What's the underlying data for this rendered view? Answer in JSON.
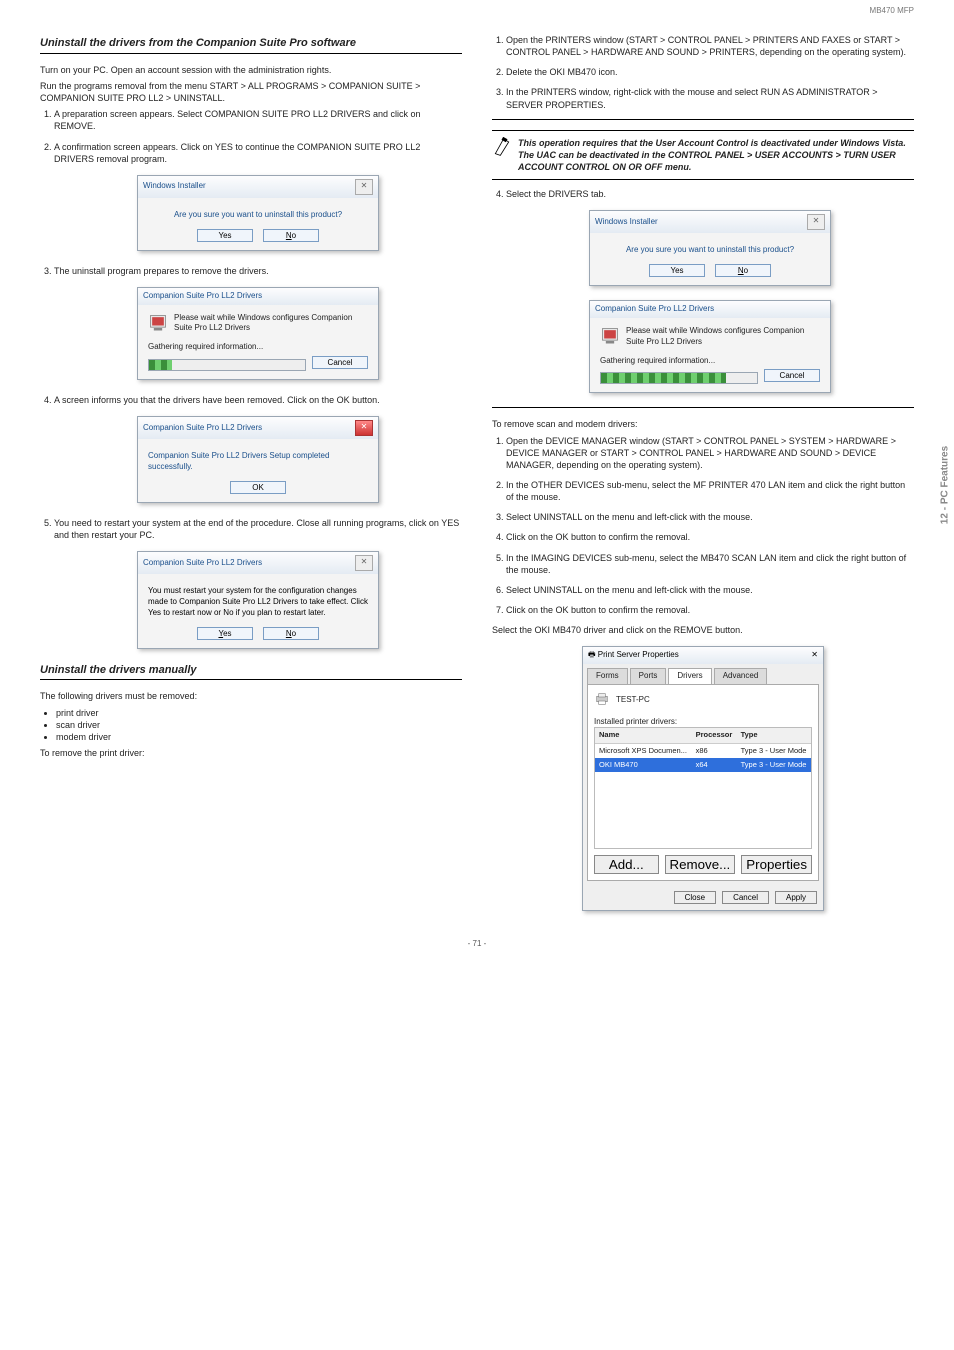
{
  "page_header_right": "MB470 MFP",
  "side_tab": "12 - PC Features",
  "footer": "- 71 -",
  "left": {
    "sec1_title": "Uninstall the drivers from the Companion Suite Pro software",
    "sec1_sub": "Turn on your PC. Open an account session with the administration rights.",
    "sec1_p1_a": "Run the programs removal from the menu START > ALL PROGRAMS > COMPANION SUITE > COMPANION SUITE PRO LL2 > UNINSTALL.",
    "sec1_step1": "A preparation screen appears. Select COMPANION SUITE PRO LL2 DRIVERS and click on REMOVE.",
    "sec1_step2": "A confirmation screen appears. Click on YES to continue the COMPANION SUITE PRO LL2 DRIVERS removal program.",
    "sec1_step3": "The uninstall program prepares to remove the drivers.",
    "sec1_step4": "A screen informs you that the drivers have been removed. Click on the OK button.",
    "sec1_step5": "You need to restart your system at the end of the procedure. Close all running programs, click on YES and then restart your PC.",
    "sec2_title": "Uninstall the drivers manually",
    "sec2_p1": "The following drivers must be removed:",
    "sec2_list": [
      "print driver",
      "scan driver",
      "modem driver"
    ],
    "sec2_p2": "To remove the print driver:"
  },
  "right": {
    "r_step1": "Open the PRINTERS window (START > CONTROL PANEL > PRINTERS AND FAXES or START > CONTROL PANEL > HARDWARE AND SOUND > PRINTERS, depending on the operating system).",
    "r_step2": "Delete the OKI MB470 icon.",
    "r_step3": "In the PRINTERS window, right-click with the mouse and select RUN AS ADMINISTRATOR > SERVER PROPERTIES.",
    "r_step4": "Select the DRIVERS tab.",
    "r_step5": "Select the OKI MB470 driver and click on the REMOVE button.",
    "note": "This operation requires that the User Account Control is deactivated under Windows Vista. The UAC can be deactivated in the CONTROL PANEL > USER ACCOUNTS > TURN USER ACCOUNT CONTROL ON OR OFF menu.",
    "r2_p1": "To remove scan and modem drivers:",
    "r2_step1": "Open the DEVICE MANAGER window (START > CONTROL PANEL > SYSTEM > HARDWARE > DEVICE MANAGER or START > CONTROL PANEL > HARDWARE AND SOUND > DEVICE MANAGER, depending on the operating system).",
    "r2_step2": "In the OTHER DEVICES sub-menu, select the MF PRINTER 470 LAN item and click the right button of the mouse.",
    "r2_step3": "Select UNINSTALL on the menu and left-click with the mouse.",
    "r2_step4": "Click on the OK button to confirm the removal.",
    "r2_step5": "In the IMAGING DEVICES sub-menu, select the MB470 SCAN LAN item and click the right button of the mouse.",
    "r2_step6": "Select UNINSTALL on the menu and left-click with the mouse.",
    "r2_step7": "Click on the OK button to confirm the removal.",
    "psp_note": "Select the OKI MB470 driver and click on the REMOVE button."
  },
  "dialogs": {
    "confirm": {
      "title": "Windows Installer",
      "msg": "Are you sure you want to uninstall this product?",
      "yes": "Yes",
      "no": "No"
    },
    "prep": {
      "title": "Companion Suite Pro LL2 Drivers",
      "msg": "Please wait while Windows configures Companion Suite Pro LL2 Drivers",
      "status": "Gathering required information...",
      "cancel": "Cancel"
    },
    "done": {
      "title": "Companion Suite Pro LL2 Drivers",
      "msg": "Companion Suite Pro LL2 Drivers Setup completed successfully.",
      "ok": "OK"
    },
    "restart": {
      "title": "Companion Suite Pro LL2 Drivers",
      "msg": "You must restart your system for the configuration changes made to Companion Suite Pro LL2 Drivers to take effect. Click Yes to restart now or No if you plan to restart later.",
      "yes": "Yes",
      "no": "No"
    }
  },
  "psp": {
    "title": "Print Server Properties",
    "tabs": [
      "Forms",
      "Ports",
      "Drivers",
      "Advanced"
    ],
    "server": "TEST-PC",
    "list_label": "Installed printer drivers:",
    "cols": [
      "Name",
      "Processor",
      "Type"
    ],
    "rows": [
      {
        "name": "Microsoft XPS Documen...",
        "proc": "x86",
        "type": "Type 3 - User Mode",
        "selected": false
      },
      {
        "name": "OKI MB470",
        "proc": "x64",
        "type": "Type 3 - User Mode",
        "selected": true
      }
    ],
    "add": "Add...",
    "remove": "Remove...",
    "props": "Properties",
    "close": "Close",
    "cancel": "Cancel",
    "apply": "Apply"
  }
}
